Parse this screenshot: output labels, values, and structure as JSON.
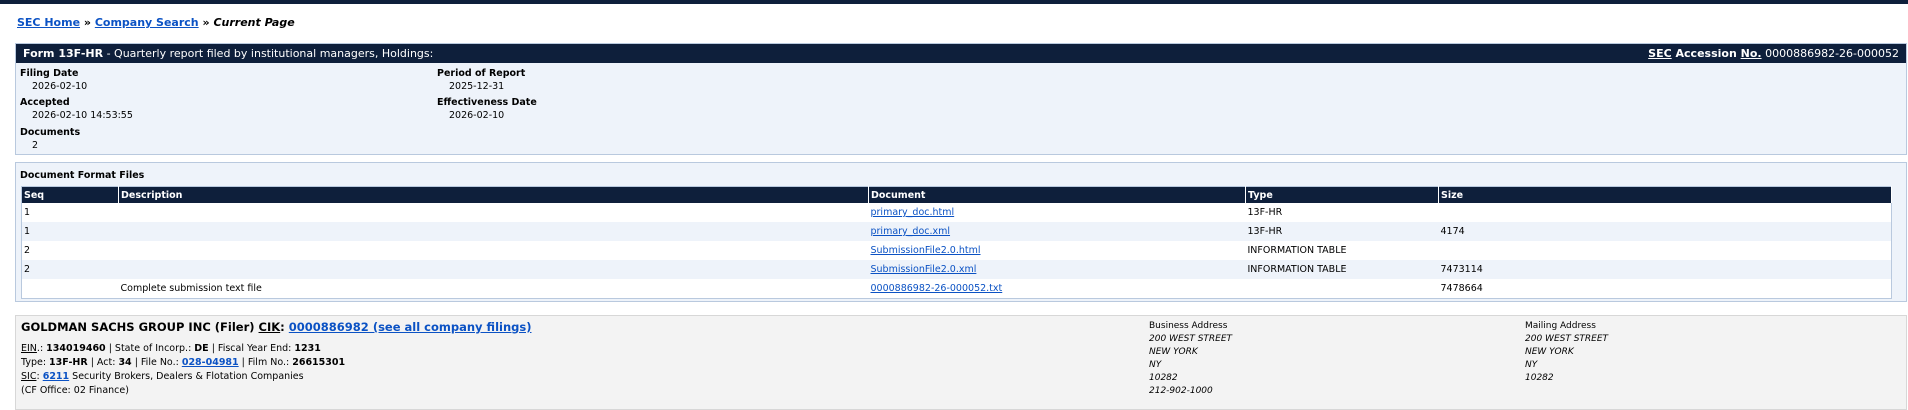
{
  "breadcrumb": {
    "home": "SEC Home",
    "sep1": "»",
    "search": "Company Search",
    "sep2": "»",
    "current": "Current Page"
  },
  "form_header": {
    "form_label": "Form 13F-HR",
    "description": " - Quarterly report filed by institutional managers, Holdings:",
    "acc_sec": "SEC",
    "acc_word": " Accession ",
    "acc_no": "No.",
    "accession_number": "0000886982-26-000052"
  },
  "filing_info": {
    "filing_date_label": "Filing Date",
    "filing_date": "2026-02-10",
    "accepted_label": "Accepted",
    "accepted": "2026-02-10 14:53:55",
    "documents_label": "Documents",
    "documents": "2",
    "period_label": "Period of Report",
    "period": "2025-12-31",
    "effectiveness_label": "Effectiveness Date",
    "effectiveness": "2026-02-10"
  },
  "documents_section": {
    "title": "Document Format Files",
    "headers": [
      "Seq",
      "Description",
      "Document",
      "Type",
      "Size"
    ],
    "rows": [
      {
        "seq": "1",
        "description": "",
        "document": "primary_doc.html",
        "type": "13F-HR",
        "size": ""
      },
      {
        "seq": "1",
        "description": "",
        "document": "primary_doc.xml",
        "type": "13F-HR",
        "size": "4174"
      },
      {
        "seq": "2",
        "description": "",
        "document": "SubmissionFile2.0.html",
        "type": "INFORMATION TABLE",
        "size": ""
      },
      {
        "seq": "2",
        "description": "",
        "document": "SubmissionFile2.0.xml",
        "type": "INFORMATION TABLE",
        "size": "7473114"
      },
      {
        "seq": "",
        "description": "Complete submission text file",
        "document": "0000886982-26-000052.txt",
        "type": "",
        "size": "7478664"
      }
    ]
  },
  "company": {
    "name": "GOLDMAN SACHS GROUP INC (Filer)",
    "cik_label": "CIK",
    "cik_colon": ":",
    "cik_link": "0000886982 (see all company filings)",
    "ein_label": "EIN",
    "ein_rest": ".: ",
    "ein": "134019460",
    "state_label": " | State of Incorp.: ",
    "state": "DE",
    "fye_label": " | Fiscal Year End: ",
    "fye": "1231",
    "type_label": "Type: ",
    "type": "13F-HR",
    "act_label": " | Act: ",
    "act": "34",
    "file_label": " | File No.: ",
    "file_no": "028-04981",
    "film_label": " | Film No.: ",
    "film_no": "26615301",
    "sic_label": "SIC",
    "sic_colon": ": ",
    "sic_code": "6211",
    "sic_desc": " Security Brokers, Dealers & Flotation Companies",
    "cf_office": "(CF Office: 02 Finance)"
  },
  "business_address": {
    "title": "Business Address",
    "line1": "200 WEST STREET",
    "line2": "NEW YORK",
    "line3": "NY",
    "line4": "10282",
    "phone": "212-902-1000"
  },
  "mailing_address": {
    "title": "Mailing Address",
    "line1": "200 WEST STREET",
    "line2": "NEW YORK",
    "line3": "NY",
    "line4": "10282"
  }
}
